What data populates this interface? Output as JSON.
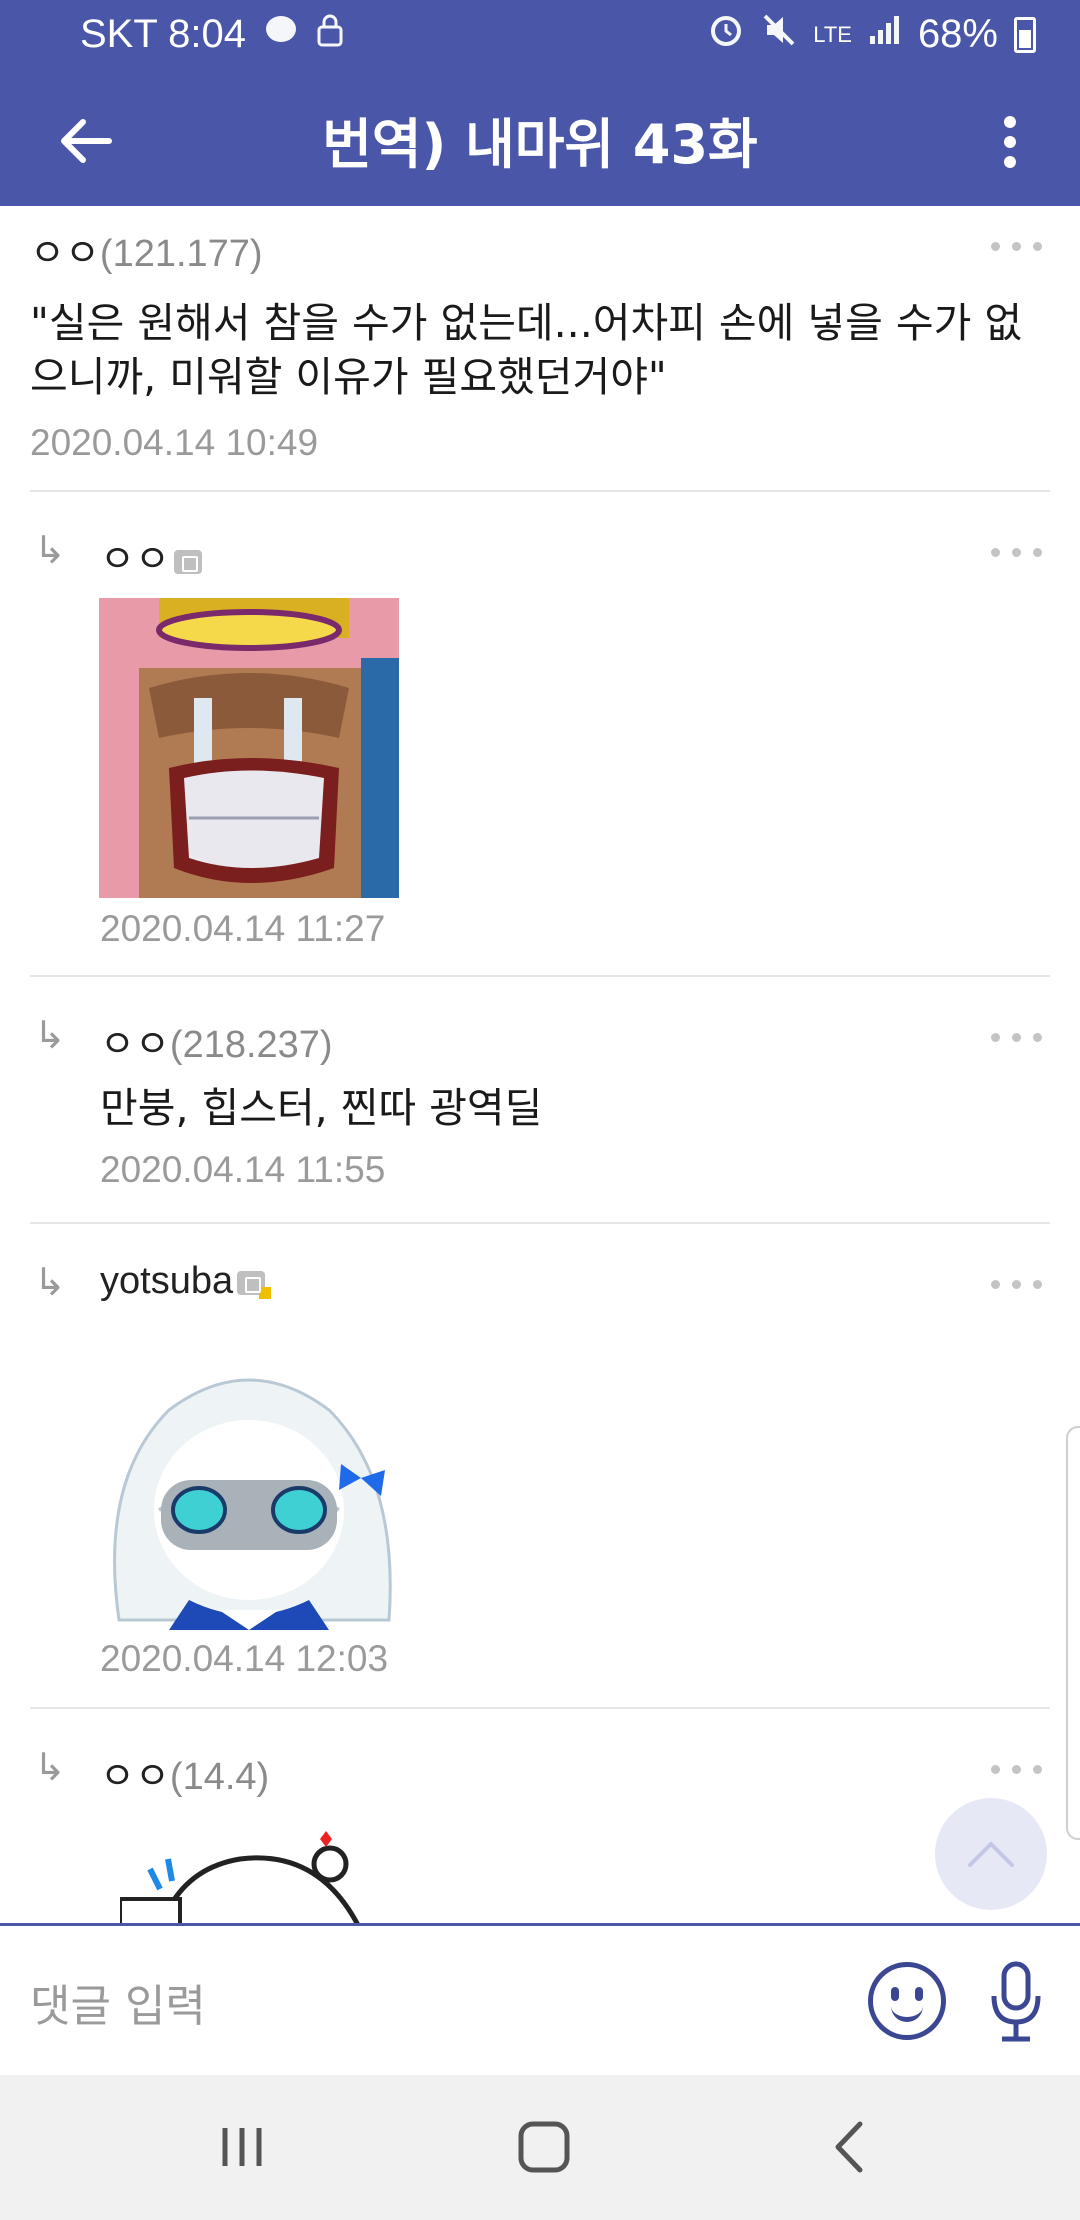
{
  "status_bar": {
    "carrier_time": "SKT 8:04",
    "network": "LTE",
    "battery": "68%"
  },
  "app_bar": {
    "title": "번역) 내마위 43화"
  },
  "comments": [
    {
      "author": "ㅇㅇ",
      "ip": "(121.177)",
      "body": "\"실은 원해서 참을 수가 없는데...어차피 손에 넣을 수가 없으니까, 미워할 이유가 필요했던거야\"",
      "date": "2020.04.14 10:49",
      "is_reply": false
    },
    {
      "author": "ㅇㅇ",
      "ip": "",
      "badge": "member-icon",
      "image": "dccon-crying-character",
      "date": "2020.04.14 11:27",
      "is_reply": true
    },
    {
      "author": "ㅇㅇ",
      "ip": "(218.237)",
      "body": "만붕, 힙스터, 찐따 광역딜",
      "date": "2020.04.14 11:55",
      "is_reply": true
    },
    {
      "author": "yotsuba",
      "ip": "",
      "badge": "fixed-member-icon",
      "image": "dccon-anime-girl",
      "date": "2020.04.14 12:03",
      "is_reply": true
    },
    {
      "author": "ㅇㅇ",
      "ip": "(14.4)",
      "image": "dccon-cartoon-animal",
      "date": "",
      "is_reply": true
    }
  ],
  "reply_marker": "↳",
  "input": {
    "placeholder": "댓글 입력"
  },
  "colors": {
    "brand": "#4a56a8",
    "meta_gray": "#9a9a9a",
    "divider": "#e6e6e6"
  }
}
